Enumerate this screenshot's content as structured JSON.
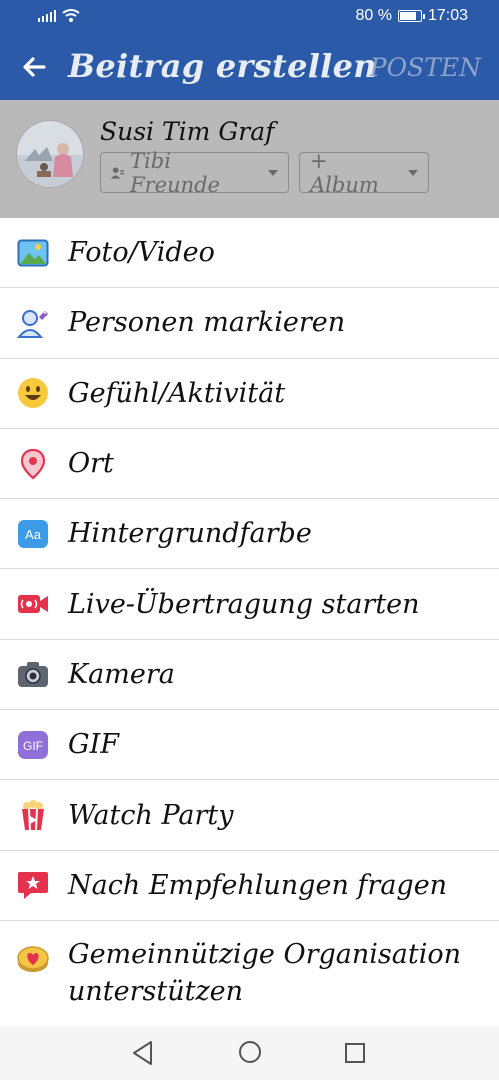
{
  "status_bar": {
    "battery": "80 %",
    "battery_level": 0.8,
    "time": "17:03"
  },
  "app_bar": {
    "title": "Beitrag erstellen",
    "post_label": "POSTEN"
  },
  "profile": {
    "name": "Susi Tim Graf",
    "audience_label": "Tibi Freunde",
    "album_label": "+ Album"
  },
  "menu": [
    {
      "label": "Foto/Video",
      "icon": "photo-icon"
    },
    {
      "label": "Personen markieren",
      "icon": "tag-people-icon"
    },
    {
      "label": "Gefühl/Aktivität",
      "icon": "smiley-icon"
    },
    {
      "label": "Ort",
      "icon": "location-pin-icon"
    },
    {
      "label": "Hintergrundfarbe",
      "icon": "background-color-icon"
    },
    {
      "label": "Live-Übertragung starten",
      "icon": "live-video-icon"
    },
    {
      "label": "Kamera",
      "icon": "camera-icon"
    },
    {
      "label": "GIF",
      "icon": "gif-icon"
    },
    {
      "label": "Watch Party",
      "icon": "popcorn-icon"
    },
    {
      "label": "Nach Empfehlungen fragen",
      "icon": "recommendation-icon"
    },
    {
      "label": "Gemeinnützige Organisation unterstützen",
      "icon": "donation-heart-icon"
    }
  ],
  "colors": {
    "brand_blue": "#2b5aa8",
    "profile_overlay": "#b9b9b9"
  }
}
